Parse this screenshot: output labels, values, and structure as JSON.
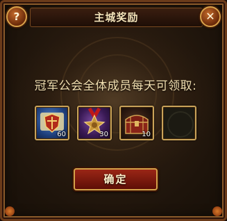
{
  "dialog": {
    "title": "主城奖励",
    "help_label": "?",
    "close_label": "✕",
    "message": "冠军公会全体成员每天可领取:",
    "rewards": [
      {
        "icon": "shield-scroll-icon",
        "count": "60"
      },
      {
        "icon": "star-medal-icon",
        "count": "30"
      },
      {
        "icon": "treasure-chest-icon",
        "count": "10"
      },
      {
        "icon": "empty-slot",
        "count": ""
      }
    ],
    "confirm_label": "确定"
  }
}
